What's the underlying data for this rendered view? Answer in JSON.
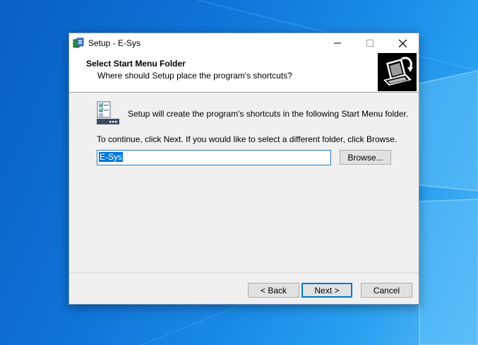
{
  "window": {
    "title": "Setup - E-Sys"
  },
  "header": {
    "title": "Select Start Menu Folder",
    "subtitle": "Where should Setup place the program's shortcuts?"
  },
  "body": {
    "info_text": "Setup will create the program's shortcuts in the following Start Menu folder.",
    "continue_text": "To continue, click Next. If you would like to select a different folder, click Browse.",
    "folder_value": "E-Sys",
    "browse_label": "Browse..."
  },
  "footer": {
    "back_label": "< Back",
    "next_label": "Next >",
    "cancel_label": "Cancel"
  },
  "colors": {
    "accent": "#0078d7",
    "desktop": "#0f74d8"
  }
}
